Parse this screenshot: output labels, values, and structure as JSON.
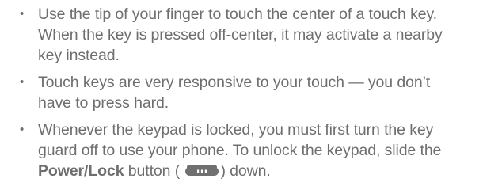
{
  "tips": [
    {
      "bullet": "•",
      "text": "Use the tip of your finger to touch the center of a touch key. When the key is pressed off-center, it may activate a nearby key instead."
    },
    {
      "bullet": "•",
      "text": "Touch keys are very responsive to your touch — you don’t have to press hard."
    },
    {
      "bullet": "•",
      "text_before": "Whenever the keypad is locked, you must first turn the key guard off to use your phone. To unlock the keypad, slide the ",
      "bold_text": "Power/Lock",
      "text_middle": " button (",
      "icon": "power-lock-button-icon",
      "text_after": ") down."
    }
  ],
  "colors": {
    "text": "#6e6e6e",
    "icon_body": "#707070",
    "icon_dots": "#ffffff"
  }
}
